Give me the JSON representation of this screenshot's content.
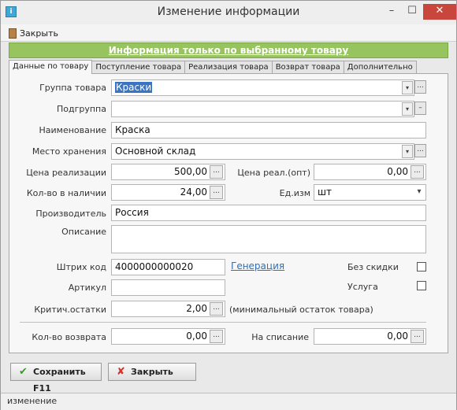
{
  "window": {
    "title": "Изменение информации",
    "minimize": "–",
    "maximize": "☐",
    "close": "✕",
    "icon": "app-icon"
  },
  "toolbar": {
    "close_label": "Закрыть"
  },
  "banner": "Информация только по выбранному товару",
  "tabs": [
    "Данные по товару",
    "Поступление товара",
    "Реализация товара",
    "Возврат товара",
    "Дополнительно"
  ],
  "form": {
    "group_label": "Группа товара",
    "group_value": "Краски",
    "subgroup_label": "Подгруппа",
    "subgroup_value": "",
    "name_label": "Наименование",
    "name_value": "Краска",
    "storage_label": "Место хранения",
    "storage_value": "Основной склад",
    "price_label": "Цена реализации",
    "price_value": "500,00",
    "price_wholesale_label": "Цена реал.(опт)",
    "price_wholesale_value": "0,00",
    "qty_label": "Кол-во в наличии",
    "qty_value": "24,00",
    "unit_label": "Ед.изм",
    "unit_value": "шт",
    "producer_label": "Производитель",
    "producer_value": "Россия",
    "description_label": "Описание",
    "description_value": "",
    "barcode_label": "Штрих код",
    "barcode_value": "4000000000020",
    "generate_link": "Генерация",
    "no_discount_label": "Без скидки",
    "service_label": "Услуга",
    "article_label": "Артикул",
    "article_value": "",
    "critical_label": "Критич.остатки",
    "critical_value": "2,00",
    "critical_hint": "(минимальный остаток товара)",
    "return_qty_label": "Кол-во возврата",
    "return_qty_value": "0,00",
    "writeoff_label": "На списание",
    "writeoff_value": "0,00"
  },
  "buttons": {
    "save": "Сохранить F11",
    "close": "Закрыть"
  },
  "status": "изменение",
  "dots": "...",
  "dropdown_arrow": "▾",
  "minus": "–",
  "colors": {
    "banner": "#97c45e",
    "link": "#2f6fb6",
    "selection": "#3a75c4",
    "close_btn": "#c8463c"
  }
}
